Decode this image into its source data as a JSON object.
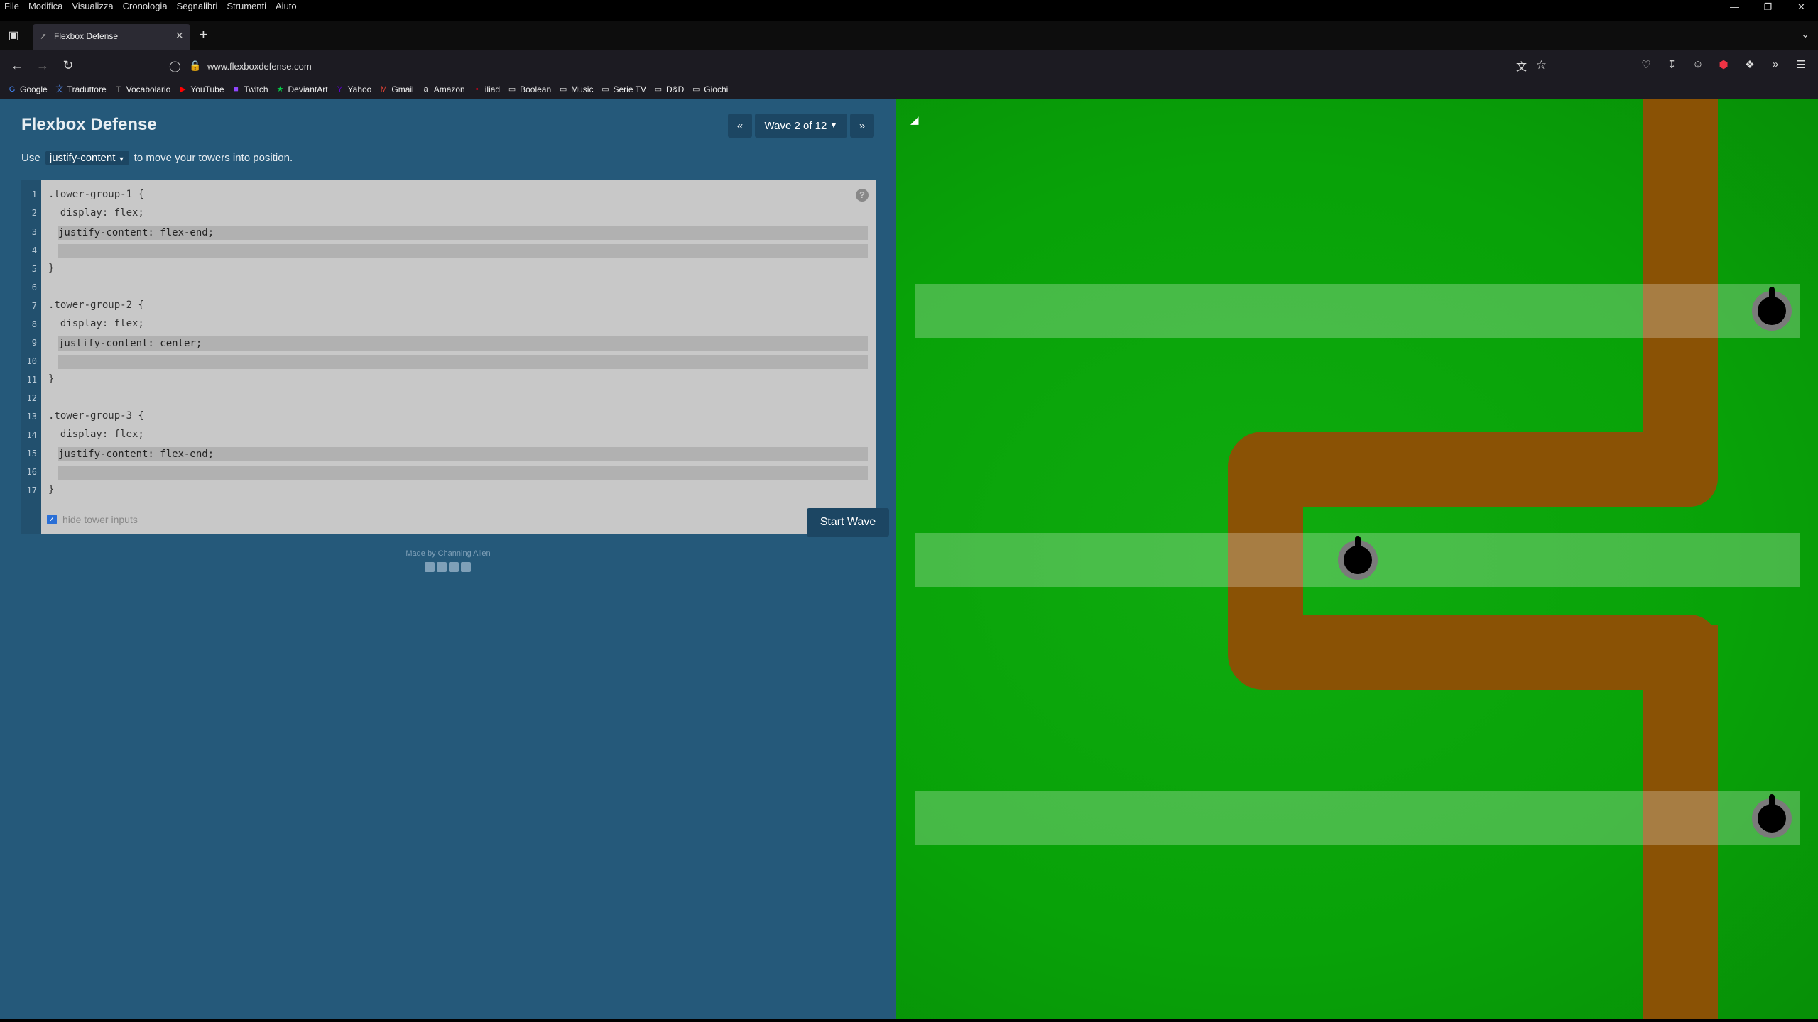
{
  "menubar": {
    "items": [
      "File",
      "Modifica",
      "Visualizza",
      "Cronologia",
      "Segnalibri",
      "Strumenti",
      "Aiuto"
    ]
  },
  "browser": {
    "tab_title": "Flexbox Defense",
    "url": "www.flexboxdefense.com"
  },
  "bookmarks": [
    {
      "label": "Google",
      "icon": "google-icon",
      "color": "#4285f4"
    },
    {
      "label": "Traduttore",
      "icon": "translate-icon",
      "color": "#4a7fd6"
    },
    {
      "label": "Vocabolario",
      "icon": "dictionary-icon",
      "color": "#777777"
    },
    {
      "label": "YouTube",
      "icon": "youtube-icon",
      "color": "#ff0000"
    },
    {
      "label": "Twitch",
      "icon": "twitch-icon",
      "color": "#9146ff"
    },
    {
      "label": "DeviantArt",
      "icon": "deviantart-icon",
      "color": "#05cc47"
    },
    {
      "label": "Yahoo",
      "icon": "yahoo-icon",
      "color": "#6001d2"
    },
    {
      "label": "Gmail",
      "icon": "gmail-icon",
      "color": "#ea4335"
    },
    {
      "label": "Amazon",
      "icon": "amazon-icon",
      "color": "#dddddd"
    },
    {
      "label": "iliad",
      "icon": "iliad-icon",
      "color": "#e2001a"
    },
    {
      "label": "Boolean",
      "icon": "folder-icon",
      "color": "#dddddd"
    },
    {
      "label": "Music",
      "icon": "folder-icon",
      "color": "#dddddd"
    },
    {
      "label": "Serie TV",
      "icon": "folder-icon",
      "color": "#dddddd"
    },
    {
      "label": "D&D",
      "icon": "folder-icon",
      "color": "#dddddd"
    },
    {
      "label": "Giochi",
      "icon": "folder-icon",
      "color": "#dddddd"
    }
  ],
  "game": {
    "title": "Flexbox Defense",
    "wave_label": "Wave 2 of 12",
    "instructions_prefix": "Use",
    "instructions_property": "justify-content",
    "instructions_suffix": "to move your towers into position.",
    "hide_inputs_label": "hide tower inputs",
    "hide_inputs_checked": true,
    "start_button": "Start Wave",
    "credit": "Made by Channing Allen"
  },
  "editor": {
    "line_numbers": [
      "1",
      "2",
      "3",
      "4",
      "5",
      "6",
      "7",
      "8",
      "9",
      "10",
      "11",
      "12",
      "13",
      "14",
      "15",
      "16",
      "17"
    ],
    "lines": {
      "l1": ".tower-group-1 {",
      "l2": "  display: flex;",
      "l3": "justify-content: flex-end;",
      "l4": "",
      "l5": "}",
      "l7": ".tower-group-2 {",
      "l8": "  display: flex;",
      "l9": "justify-content: center;",
      "l10": "",
      "l11": "}",
      "l13": ".tower-group-3 {",
      "l14": "  display: flex;",
      "l15": "justify-content: flex-end;",
      "l16": "",
      "l17": "}"
    }
  },
  "colors": {
    "panel": "#25597a",
    "board_green": "#08a208",
    "path_brown": "#8a5205"
  }
}
